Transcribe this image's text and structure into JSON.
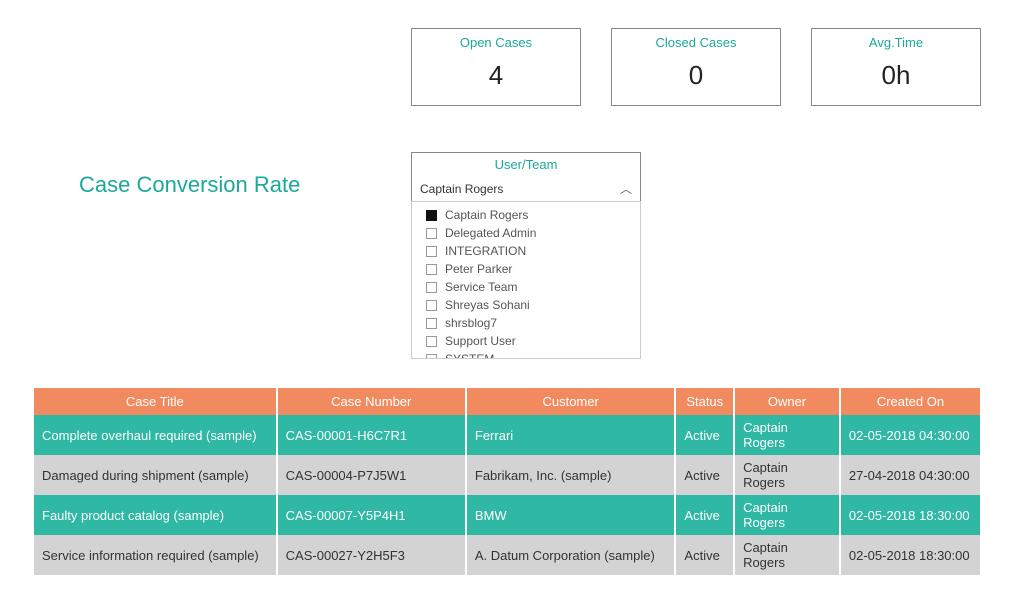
{
  "kpis": [
    {
      "title": "Open Cases",
      "value": "4"
    },
    {
      "title": "Closed Cases",
      "value": "0"
    },
    {
      "title": "Avg.Time",
      "value": "0h"
    }
  ],
  "heading": "Case Conversion Rate",
  "slicer": {
    "title": "User/Team",
    "selected": "Captain Rogers",
    "options": [
      {
        "label": "Captain Rogers",
        "selected": true
      },
      {
        "label": "Delegated Admin",
        "selected": false
      },
      {
        "label": "INTEGRATION",
        "selected": false
      },
      {
        "label": "Peter Parker",
        "selected": false
      },
      {
        "label": "Service Team",
        "selected": false
      },
      {
        "label": "Shreyas Sohani",
        "selected": false
      },
      {
        "label": "shrsblog7",
        "selected": false
      },
      {
        "label": "Support User",
        "selected": false
      },
      {
        "label": "SYSTEM",
        "selected": false
      }
    ]
  },
  "table": {
    "headers": [
      "Case Title",
      "Case Number",
      "Customer",
      "Status",
      "Owner",
      "Created On"
    ],
    "rows": [
      [
        "Complete overhaul required (sample)",
        "CAS-00001-H6C7R1",
        "Ferrari",
        "Active",
        "Captain Rogers",
        "02-05-2018 04:30:00"
      ],
      [
        "Damaged during shipment (sample)",
        "CAS-00004-P7J5W1",
        "Fabrikam, Inc. (sample)",
        "Active",
        "Captain Rogers",
        "27-04-2018 04:30:00"
      ],
      [
        "Faulty product catalog (sample)",
        "CAS-00007-Y5P4H1",
        "BMW",
        "Active",
        "Captain Rogers",
        "02-05-2018 18:30:00"
      ],
      [
        "Service information required (sample)",
        "CAS-00027-Y2H5F3",
        "A. Datum Corporation (sample)",
        "Active",
        "Captain Rogers",
        "02-05-2018 18:30:00"
      ]
    ]
  }
}
